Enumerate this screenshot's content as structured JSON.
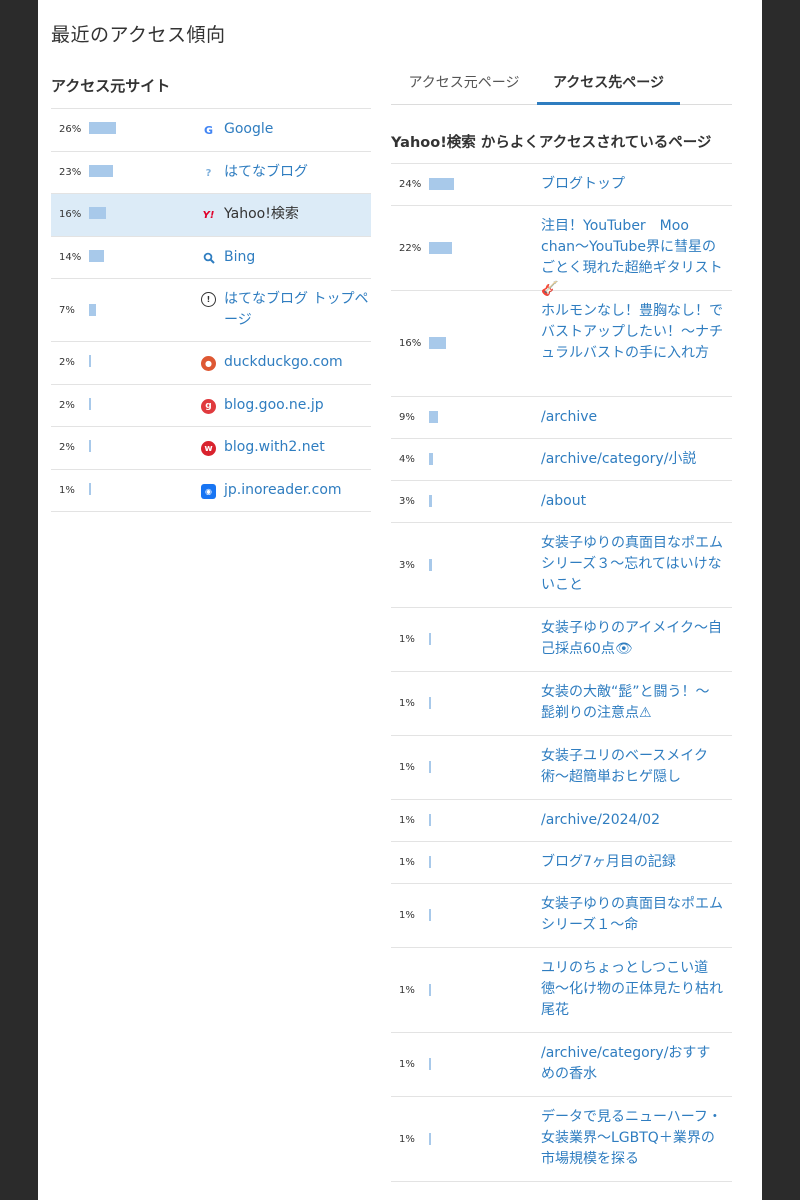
{
  "page_title": "最近のアクセス傾向",
  "sources": {
    "heading": "アクセス元サイト",
    "items": [
      {
        "percent": "26%",
        "value": 26,
        "icon": "google-icon",
        "label": "Google"
      },
      {
        "percent": "23%",
        "value": 23,
        "icon": "hatena-blog-icon",
        "label": "はてなブログ"
      },
      {
        "percent": "16%",
        "value": 16,
        "icon": "yahoo-icon",
        "label": "Yahoo!検索"
      },
      {
        "percent": "14%",
        "value": 14,
        "icon": "search-icon",
        "label": "Bing"
      },
      {
        "percent": "7%",
        "value": 7,
        "icon": "hatena-top-icon",
        "label": "はてなブログ トップページ"
      },
      {
        "percent": "2%",
        "value": 2,
        "icon": "duckduckgo-icon",
        "label": "duckduckgo.com"
      },
      {
        "percent": "2%",
        "value": 2,
        "icon": "goo-icon",
        "label": "blog.goo.ne.jp"
      },
      {
        "percent": "2%",
        "value": 2,
        "icon": "with2-icon",
        "label": "blog.with2.net"
      },
      {
        "percent": "1%",
        "value": 1,
        "icon": "inoreader-icon",
        "label": "jp.inoreader.com"
      }
    ]
  },
  "tabs": [
    "アクセス元ページ",
    "アクセス先ページ"
  ],
  "destinations": {
    "heading": "Yahoo!検索 からよくアクセスされているページ",
    "items": [
      {
        "percent": "24%",
        "value": 24,
        "label": "ブログトップ"
      },
      {
        "percent": "22%",
        "value": 22,
        "label": "注目！YouTuber　Moo chan〜YouTube界に彗星のごとく現れた超絶ギタリスト🎸"
      },
      {
        "percent": "16%",
        "value": 16,
        "label": "ホルモンなし！豊胸なし！でバストアップしたい！〜ナチュラルバストの手に入れ方"
      },
      {
        "percent": "9%",
        "value": 9,
        "label": "/archive"
      },
      {
        "percent": "4%",
        "value": 4,
        "label": "/archive/category/小説"
      },
      {
        "percent": "3%",
        "value": 3,
        "label": "/about"
      },
      {
        "percent": "3%",
        "value": 3,
        "label": "女装子ゆりの真面目なポエムシリーズ３〜忘れてはいけないこと"
      },
      {
        "percent": "1%",
        "value": 1,
        "label": "女装子ゆりのアイメイク〜自己採点60点👁"
      },
      {
        "percent": "1%",
        "value": 1,
        "label": "女装の大敵“髭”と闘う！〜髭剃りの注意点⚠"
      },
      {
        "percent": "1%",
        "value": 1,
        "label": "女装子ユリのベースメイク術〜超簡単おヒゲ隠し"
      },
      {
        "percent": "1%",
        "value": 1,
        "label": "/archive/2024/02"
      },
      {
        "percent": "1%",
        "value": 1,
        "label": "ブログ7ヶ月目の記録"
      },
      {
        "percent": "1%",
        "value": 1,
        "label": "女装子ゆりの真面目なポエムシリーズ１〜命"
      },
      {
        "percent": "1%",
        "value": 1,
        "label": "ユリのちょっとしつこい道徳〜化け物の正体見たり枯れ尾花"
      },
      {
        "percent": "1%",
        "value": 1,
        "label": "/archive/category/おすすめの香水"
      },
      {
        "percent": "1%",
        "value": 1,
        "label": "データで見るニューハーフ・女装業界〜LGBTQ＋業界の市場規模を探る"
      }
    ]
  }
}
